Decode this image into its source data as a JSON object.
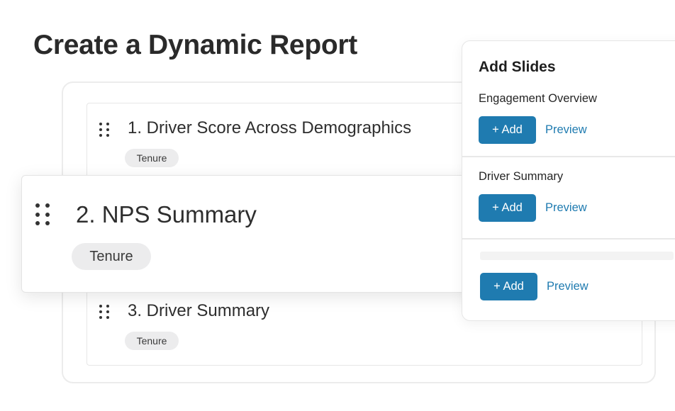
{
  "page": {
    "title": "Create a Dynamic Report"
  },
  "slides": [
    {
      "title": "1. Driver Score Across Demographics",
      "tag": "Tenure"
    },
    {
      "title": "2. NPS Summary",
      "tag": "Tenure"
    },
    {
      "title": "3. Driver Summary",
      "tag": "Tenure"
    }
  ],
  "add_panel": {
    "title": "Add Slides",
    "sections": [
      {
        "label": "Engagement Overview",
        "add_label": "+ Add",
        "preview_label": "Preview"
      },
      {
        "label": "Driver Summary",
        "add_label": "+ Add",
        "preview_label": "Preview"
      },
      {
        "label": "",
        "add_label": "+ Add",
        "preview_label": "Preview"
      }
    ]
  },
  "colors": {
    "accent": "#1f7bb0",
    "tag_bg": "#ececed",
    "border": "#e6e6e6"
  },
  "icons": {
    "drag_handle": "drag-handle-icon"
  }
}
